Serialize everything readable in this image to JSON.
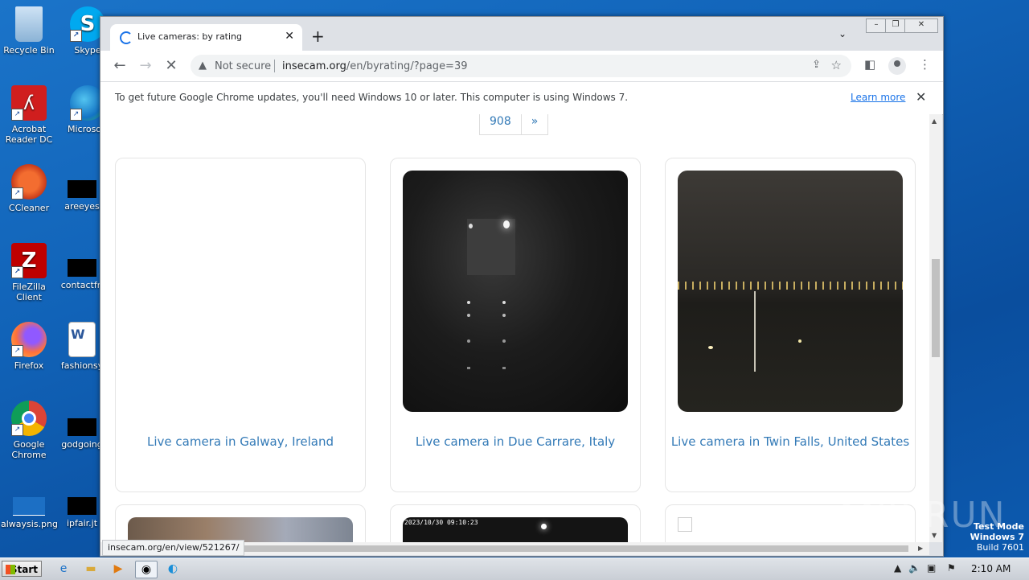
{
  "desktop": {
    "icons": [
      {
        "label": "Recycle Bin"
      },
      {
        "label": "Skype"
      },
      {
        "label": "Acrobat Reader DC"
      },
      {
        "label": "Microsoft"
      },
      {
        "label": "CCleaner"
      },
      {
        "label": "areeyes"
      },
      {
        "label": "FileZilla Client"
      },
      {
        "label": "contactfri"
      },
      {
        "label": "Firefox"
      },
      {
        "label": "fashionsy"
      },
      {
        "label": "Google Chrome"
      },
      {
        "label": "godgoing"
      },
      {
        "label": "alwaysis.png"
      },
      {
        "label": "ipfair.jt"
      }
    ],
    "anyrun_logo": "ANY RUN"
  },
  "browser": {
    "tab_title": "Live cameras: by rating",
    "omnibox": {
      "security": "Not secure",
      "url_host": "insecam.org",
      "url_path": "/en/byrating/?page=39"
    },
    "infobar": {
      "message": "To get future Google Chrome updates, you'll need Windows 10 or later. This computer is using Windows 7.",
      "link": "Learn more"
    },
    "status_url": "insecam.org/en/view/521267/"
  },
  "page": {
    "pager": [
      "908",
      "»"
    ],
    "cameras": [
      {
        "caption": "Live camera in Galway, Ireland"
      },
      {
        "caption": "Live camera in Due Carrare, Italy"
      },
      {
        "caption": "Live camera in Twin Falls, United States"
      }
    ],
    "second_row_overlay": "2023/10/30 09:10:23"
  },
  "watermark": {
    "line1": "Test Mode",
    "line2": "Windows 7",
    "line3": "Build 7601"
  },
  "taskbar": {
    "start": "Start",
    "clock": "2:10 AM"
  }
}
